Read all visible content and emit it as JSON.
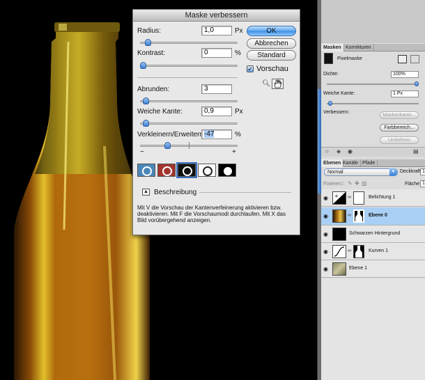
{
  "dialog": {
    "title": "Maske verbessern",
    "radius": {
      "label": "Radius:",
      "value": "1,0",
      "unit": "Px",
      "level": 0.05
    },
    "kontrast": {
      "label": "Kontrast:",
      "value": "0",
      "unit": "%",
      "level": 0.0
    },
    "abrunden": {
      "label": "Abrunden:",
      "value": "3",
      "level": 0.03
    },
    "weiche_kante": {
      "label": "Weiche Kante:",
      "value": "0,9",
      "unit": "Px",
      "level": 0.03
    },
    "verkleinern": {
      "label": "Verkleinern/Erweitern:",
      "value": "-47",
      "unit": "%",
      "level": 0.27,
      "minus": "−",
      "plus": "+"
    },
    "ok_label": "OK",
    "abbrechen_label": "Abbrechen",
    "standard_label": "Standard",
    "vorschau_label": "Vorschau",
    "check_mark": "✓",
    "beschreibung_label": "Beschreibung",
    "description": "Mit V die Vorschau der Kantenverfeinerung aktivieren bzw. deaktivieren. Mit F die Vorschaumodi durchlaufen. Mit X das Bild vorübergehend anzeigen.",
    "view_modes": [
      "standard",
      "quick-mask",
      "on-black",
      "on-white",
      "mask"
    ]
  },
  "masks_panel": {
    "tabs": [
      "Masken",
      "Korrekturen"
    ],
    "pixelmaske_label": "Pixelmaske",
    "dichte_label": "Dichte:",
    "dichte_value": "100%",
    "dichte_level": 1.0,
    "weiche_kante_label": "Weiche Kante:",
    "weiche_kante_value": "1 Px",
    "verbessern_label": "Verbessern:",
    "maskenkante_label": "Maskenkante...",
    "farbbereich_label": "Farbbereich...",
    "umkehren_label": "Umkehren"
  },
  "layers_panel": {
    "tabs": [
      "Ebenen",
      "Kanäle",
      "Pfade"
    ],
    "blend_mode": "Normal",
    "deckkraft_label": "Deckkraft:",
    "deckkraft_value": "1",
    "fixieren_label": "Fixieren:",
    "flaeche_label": "Fläche:",
    "flaeche_value": "1",
    "layers": [
      {
        "name": "Belichtung 1",
        "selected": false
      },
      {
        "name": "Ebene 0",
        "selected": true
      },
      {
        "name": "Schwarzen Hintergrund",
        "selected": false
      },
      {
        "name": "Kurven 1",
        "selected": false
      },
      {
        "name": "Ebene 1",
        "selected": false
      }
    ]
  },
  "colors": {
    "accent": "#3f8ee3",
    "selection": "#a9cff4",
    "bottle": "#b8700f"
  }
}
